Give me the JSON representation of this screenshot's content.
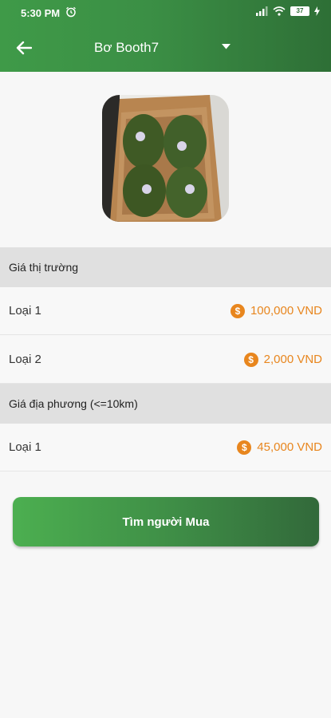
{
  "status": {
    "time": "5:30 PM",
    "battery": "37"
  },
  "appbar": {
    "title": "Bơ Booth7"
  },
  "product": {
    "image_alt": "avocado-box-photo"
  },
  "market_price": {
    "header": "Giá thị trường",
    "rows": [
      {
        "label": "Loại 1",
        "price": "100,000 VND"
      },
      {
        "label": "Loại 2",
        "price": "2,000 VND"
      }
    ]
  },
  "local_price": {
    "header": "Giá địa phương (<=10km)",
    "rows": [
      {
        "label": "Loại 1",
        "price": "45,000 VND"
      }
    ]
  },
  "cta": {
    "label": "Tìm người Mua"
  },
  "colors": {
    "brand_green": "#3b8f45",
    "price_orange": "#e8861e",
    "section_bg": "#e0e0e0"
  },
  "icons": {
    "back": "arrow-left-icon",
    "dropdown": "caret-down-icon",
    "coin": "dollar-coin-icon"
  }
}
